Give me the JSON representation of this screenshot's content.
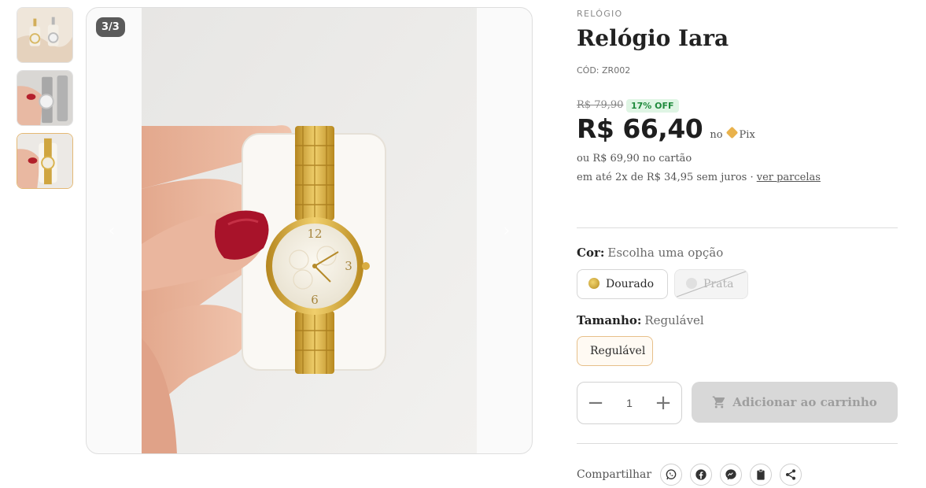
{
  "gallery": {
    "counter": "3/3",
    "thumbnails": [
      {
        "name": "thumb-two-watches"
      },
      {
        "name": "thumb-silver-watch"
      },
      {
        "name": "thumb-gold-watch",
        "active": true
      }
    ],
    "prev_icon": "‹",
    "next_icon": "›",
    "watch_numerals": {
      "twelve": "12",
      "three": "3",
      "six": "6"
    }
  },
  "product": {
    "category": "RELÓGIO",
    "title": "Relógio Iara",
    "code": "CÓD: ZR002",
    "old_price": "R$ 79,90",
    "discount": "17% OFF",
    "price": "R$ 66,40",
    "pix_prefix": "no",
    "pix_label": "Pix",
    "card_price": "ou R$ 69,90 no cartão",
    "installments_text": "em até 2x de R$ 34,95 sem juros · ",
    "installments_link": "ver parcelas"
  },
  "options": {
    "color": {
      "label": "Cor:",
      "hint": "Escolha uma opção",
      "choices": [
        {
          "label": "Dourado",
          "color": "#c9a227",
          "available": true
        },
        {
          "label": "Prata",
          "color": "#cfcfcf",
          "available": false
        }
      ]
    },
    "size": {
      "label": "Tamanho:",
      "value": "Regulável",
      "choices": [
        {
          "label": "Regulável",
          "selected": true
        }
      ]
    }
  },
  "cart": {
    "minus": "−",
    "plus": "+",
    "quantity": "1",
    "add_label": "Adicionar ao carrinho"
  },
  "share": {
    "label": "Compartilhar",
    "icons": [
      "whatsapp-icon",
      "facebook-icon",
      "messenger-icon",
      "clipboard-icon",
      "share-icon"
    ]
  },
  "colors": {
    "accent_border": "#e4b874",
    "discount_bg": "#dff5e4",
    "discount_text": "#1f8a3c",
    "button_disabled": "#d8d8d8"
  }
}
